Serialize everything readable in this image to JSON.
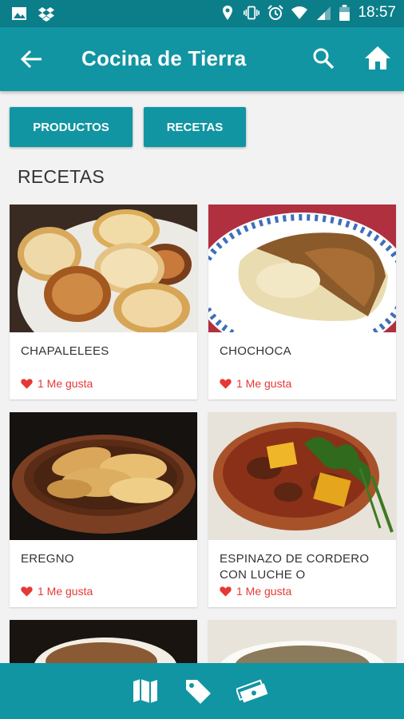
{
  "status_bar": {
    "time": "18:57",
    "icons": [
      "image-icon",
      "dropbox-icon",
      "location-icon",
      "vibrate-icon",
      "alarm-icon",
      "wifi-icon",
      "signal-icon",
      "battery-icon"
    ]
  },
  "app_bar": {
    "title": "Cocina de Tierra",
    "icons": [
      "back-arrow-icon",
      "search-icon",
      "home-icon"
    ]
  },
  "tabs": {
    "productos": "PRODUCTOS",
    "recetas": "RECETAS"
  },
  "section_title": "RECETAS",
  "recipes": [
    {
      "name": "CHAPALELEES",
      "likes": "1 Me gusta"
    },
    {
      "name": "CHOCHOCA",
      "likes": "1 Me gusta"
    },
    {
      "name": "EREGNO",
      "likes": "1 Me gusta"
    },
    {
      "name": "ESPINAZO DE CORDERO CON LUCHE O",
      "likes": "1 Me gusta"
    }
  ],
  "bottom_nav": {
    "icons": [
      "map-icon",
      "tag-icon",
      "money-icon"
    ]
  },
  "colors": {
    "status_bar": "#0c7e8a",
    "primary": "#1195a2",
    "like_red": "#e53935",
    "background": "#f2f2f2"
  }
}
